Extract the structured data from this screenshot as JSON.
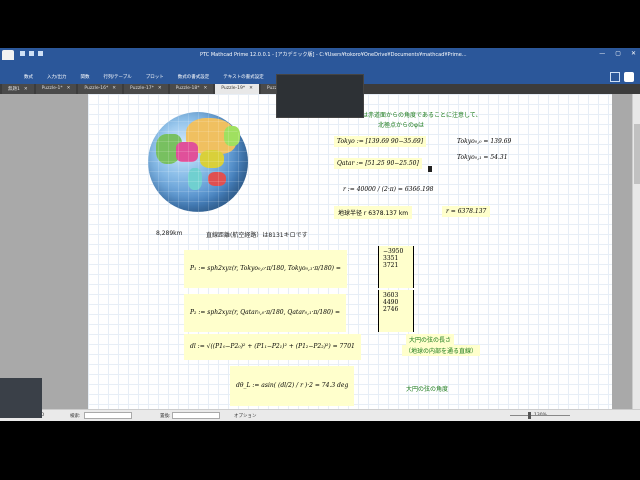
{
  "window": {
    "title": "PTC Mathcad Prime 12.0.0.1 - [アカデミック版] - C:¥Users¥tokoro¥OneDrive¥Documents¥mathcad¥Prime...",
    "controls": [
      "—",
      "▢",
      "✕"
    ]
  },
  "ribbon": {
    "tabs": [
      "数式",
      "入力/出力",
      "関数",
      "行列/テーブル",
      "プロット",
      "数式の書式設定",
      "テキストの書式設定",
      "計"
    ]
  },
  "doc_tabs": [
    {
      "label": "無題1",
      "active": false
    },
    {
      "label": "Puzzle-1*",
      "active": false
    },
    {
      "label": "Puzzle-16*",
      "active": false
    },
    {
      "label": "Puzzle-17*",
      "active": false
    },
    {
      "label": "Puzzle-18*",
      "active": false
    },
    {
      "label": "Puzzle-19*",
      "active": true
    },
    {
      "label": "Puzzle-20",
      "active": false
    }
  ],
  "worksheet": {
    "note_top": "度は赤道面からの角度であることに注意して、",
    "note_top2": "北極点からのφは",
    "tokyo_def": "Tokyo := [139.69  90−35.69]",
    "tokyo_00": "Tokyo₀,₀ = 139.69",
    "qatar_def": "Qatar := [51.25  90−25.50]",
    "tokyo_01": "Tokyo₀,₁ = 54.31",
    "r_def": "r := 40000 / (2·π) = 6366.198",
    "earth_radius_text": "地球半径 r 6378.137 km",
    "r_value": "r = 6378.137",
    "distance_km": "8,289km",
    "direct_distance_text": "直線距離(航空経路）は8131キロです",
    "p1_def": "P₁ := sph2xyz(r, Tokyo₀,₀·π/180, Tokyo₀,₁·π/180) =",
    "p1_values": [
      "−3950",
      "3351",
      "3721"
    ],
    "p2_def": "P₂ := sph2xyz(r, Qatar₀,₀·π/180, Qatar₀,₁·π/180) =",
    "p2_values": [
      "3603",
      "4490",
      "2746"
    ],
    "dl_def": "dl := √((P1₀−P2₀)² + (P1₁−P2₁)² + (P1₂−P2₂)²) = 7701",
    "chord_label1": "大円の弦の長さ",
    "chord_label2": "（地球の内部を通る直線）",
    "dtheta_def": "dθ_L := asin( (dl/2) / r )·2 = 74.3 deg",
    "chord_angle_label": "大円の弦の角度"
  },
  "statusbar": {
    "page": "TO",
    "search_label": "検索:",
    "replace_label": "置換:",
    "options_label": "オプション",
    "zoom": "130%"
  }
}
